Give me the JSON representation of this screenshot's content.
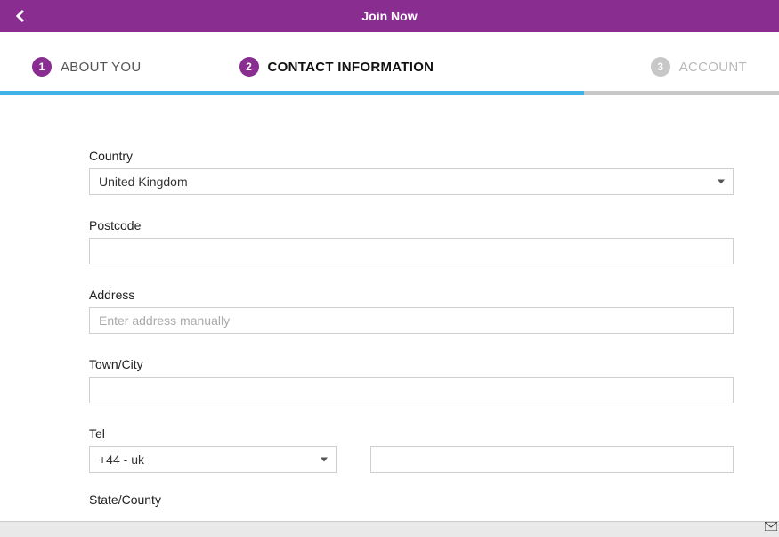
{
  "header": {
    "title": "Join Now"
  },
  "steps": {
    "s1": {
      "num": "1",
      "label": "ABOUT YOU"
    },
    "s2": {
      "num": "2",
      "label": "CONTACT INFORMATION"
    },
    "s3": {
      "num": "3",
      "label": "ACCOUNT"
    }
  },
  "form": {
    "country": {
      "label": "Country",
      "value": "United Kingdom"
    },
    "postcode": {
      "label": "Postcode",
      "value": ""
    },
    "address": {
      "label": "Address",
      "placeholder": "Enter address manually",
      "value": ""
    },
    "town": {
      "label": "Town/City",
      "value": ""
    },
    "tel": {
      "label": "Tel",
      "code_value": "+44 - uk",
      "number_value": ""
    },
    "state": {
      "label": "State/County",
      "value": ""
    }
  }
}
